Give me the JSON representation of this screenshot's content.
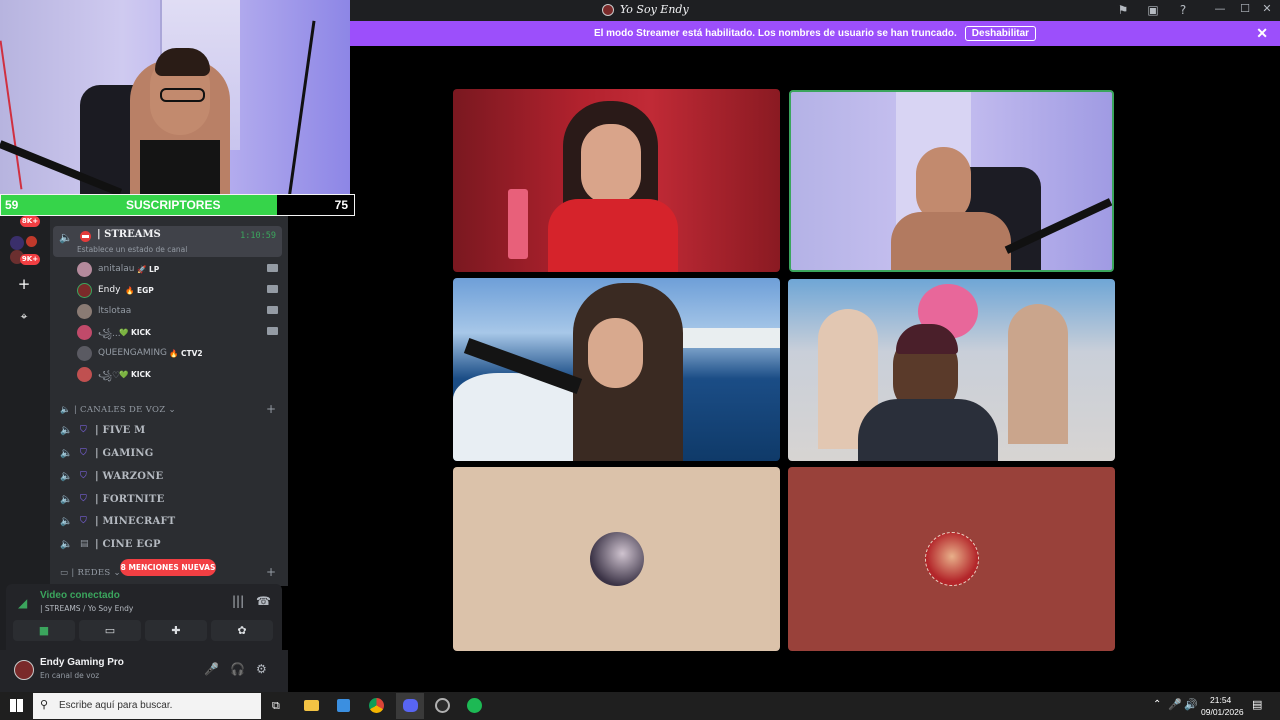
{
  "window": {
    "title": "Yo Soy Endy",
    "controls": {
      "minimize": "—",
      "maximize": "☐",
      "close": "✕"
    },
    "toolbar_icons": [
      "inbox-flag-icon",
      "inbox-icon",
      "help-icon"
    ]
  },
  "banner": {
    "message": "El modo Streamer está habilitado. Los nombres de usuario se han truncado.",
    "button": "Deshabilitar",
    "close": "✕",
    "color": "#9c4ffb"
  },
  "sub_goal": {
    "current": "59",
    "label": "SUSCRIPTORES",
    "goal": "75",
    "progress_fraction": 0.787,
    "fill_color": "#36d44a"
  },
  "rail": {
    "badges": [
      "8K+",
      "9K+"
    ],
    "add_server": "+",
    "discover": "⌖"
  },
  "sidebar": {
    "active_channel": {
      "name": "| STREAMS",
      "status": "Establece un estado de canal",
      "timer": "1:10:59"
    },
    "voice_users": [
      {
        "name": "anitalau",
        "tag": "🚀 LP"
      },
      {
        "name": "Endy",
        "tag": "🔥 EGP"
      },
      {
        "name": "ltslotaa",
        "tag": ""
      },
      {
        "name": "꧁...",
        "tag": "💚 KICK"
      },
      {
        "name": "QUEENGAMING",
        "tag": "🔥 CTV2"
      },
      {
        "name": "꧁♡",
        "tag": "💚 KICK"
      }
    ],
    "voice_category": "| CANALES DE VOZ",
    "voice_channels": [
      "| FIVE M",
      "| GAMING",
      "| WARZONE",
      "| FORTNITE",
      "| MINECRAFT",
      "| CINE EGP"
    ],
    "redes_category": "| REDES",
    "mentions": "8 MENCIONES NUEVAS"
  },
  "voice_panel": {
    "status": "Video conectado",
    "channel_path": "| STREAMS / Yo Soy Endy",
    "buttons": [
      "camera-icon",
      "screen-share-icon",
      "activities-icon",
      "soundboard-icon"
    ]
  },
  "user_panel": {
    "name": "Endy Gaming Pro",
    "status": "En canal de voz"
  },
  "taskbar": {
    "search_placeholder": "Escribe aquí para buscar.",
    "time": "21:54",
    "date": "09/01/2026"
  }
}
